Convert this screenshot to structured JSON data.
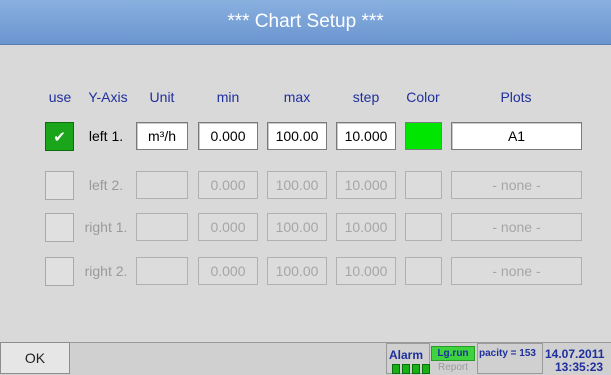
{
  "title": "***  Chart Setup  ***",
  "headers": {
    "use": "use",
    "y_axis": "Y-Axis",
    "unit": "Unit",
    "min": "min",
    "max": "max",
    "step": "step",
    "color": "Color",
    "plots": "Plots"
  },
  "rows": [
    {
      "checked": true,
      "check_mark": "✔",
      "label": "left 1.",
      "unit": "m³/h",
      "min": "0.000",
      "max": "100.00",
      "step": "10.000",
      "color": "#00e600",
      "plots": "A1"
    },
    {
      "checked": false,
      "label": "left 2.",
      "unit": "",
      "min": "0.000",
      "max": "100.00",
      "step": "10.000",
      "color": "",
      "plots": "- none -"
    },
    {
      "checked": false,
      "label": "right 1.",
      "unit": "",
      "min": "0.000",
      "max": "100.00",
      "step": "10.000",
      "color": "",
      "plots": "- none -"
    },
    {
      "checked": false,
      "label": "right 2.",
      "unit": "",
      "min": "0.000",
      "max": "100.00",
      "step": "10.000",
      "color": "",
      "plots": "- none -"
    }
  ],
  "status": {
    "ok": "OK",
    "alarm": "Alarm",
    "lg_run": "Lg.run",
    "report": "Report",
    "capacity": "pacity = 153",
    "date": "14.07.2011",
    "time": "13:35:23"
  }
}
